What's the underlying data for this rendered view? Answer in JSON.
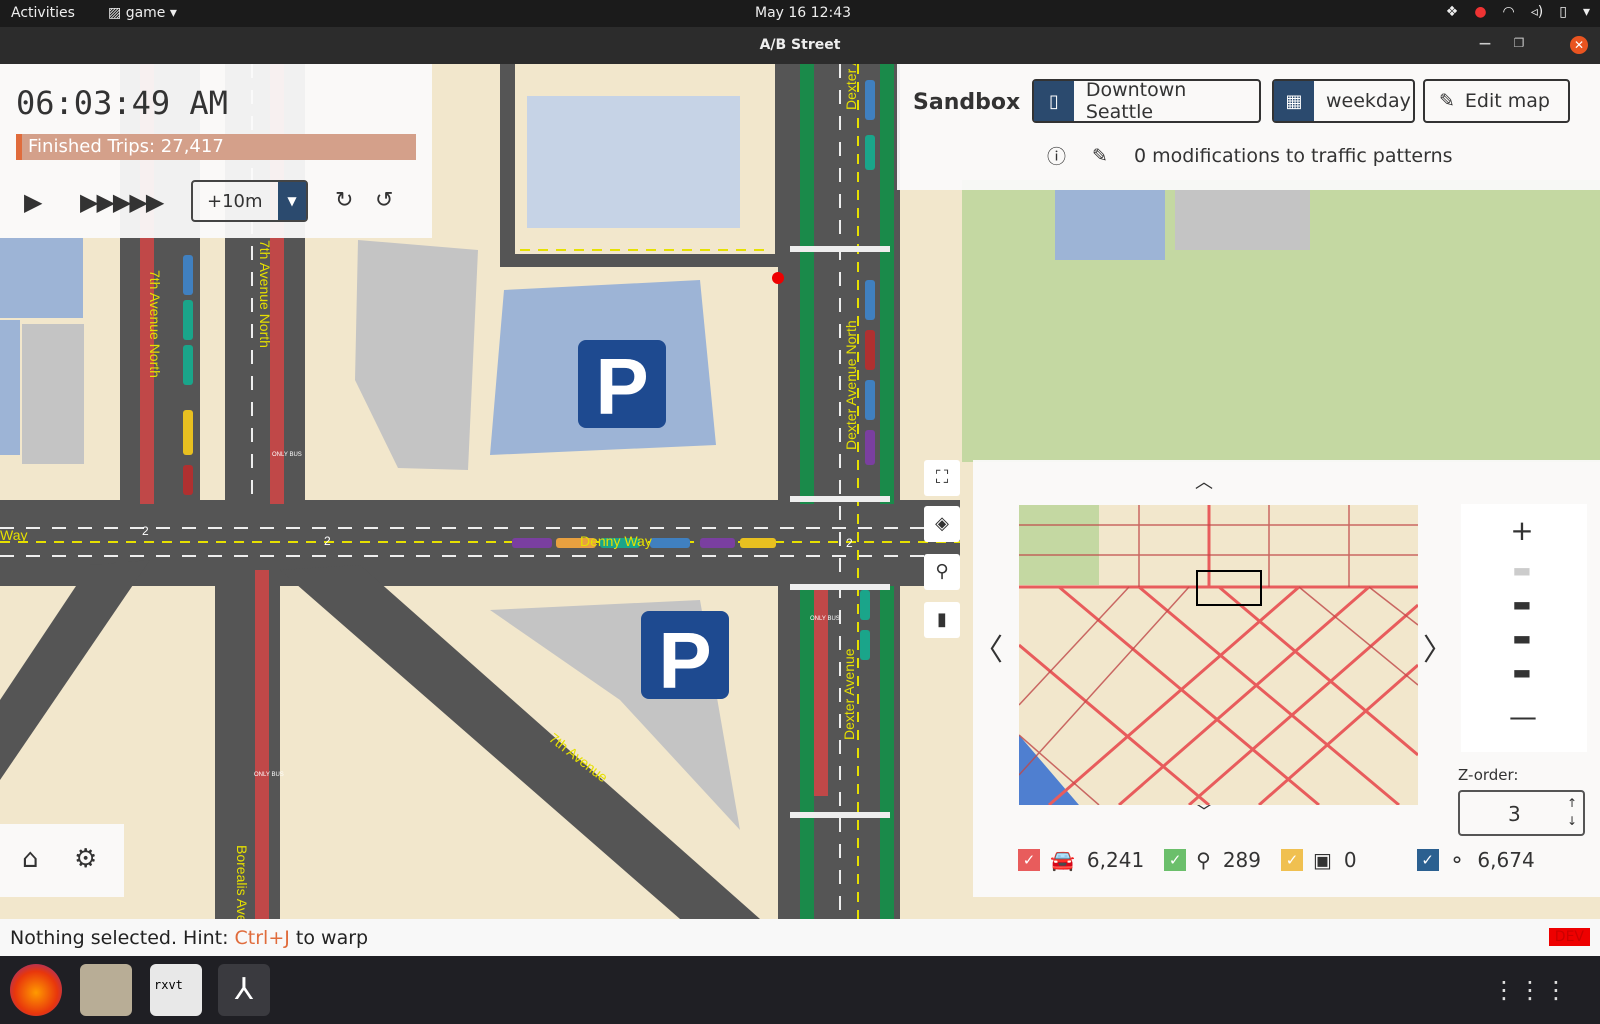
{
  "topbar": {
    "activities": "Activities",
    "app_menu": "game",
    "clock": "May 16  12:43"
  },
  "window": {
    "title": "A/B Street"
  },
  "time_panel": {
    "time": "06:03:49 AM",
    "finished_trips": "Finished Trips: 27,417",
    "step": "+10m",
    "progress_fraction": 0.03
  },
  "sandbox": {
    "label": "Sandbox",
    "map_name": "Downtown Seattle",
    "scenario": "weekday",
    "edit_label": "Edit map",
    "mods_text": "0 modifications to traffic patterns"
  },
  "minimap": {
    "zorder_label": "Z-order:",
    "zorder_value": "3",
    "agents": [
      {
        "name": "car",
        "icon": "car-icon",
        "count": "6,241",
        "color": "#e85c5c"
      },
      {
        "name": "bike",
        "icon": "bike-icon",
        "count": "289",
        "color": "#6bbf6b"
      },
      {
        "name": "bus",
        "icon": "bus-icon",
        "count": "0",
        "color": "#f0c050"
      },
      {
        "name": "pedestrian",
        "icon": "walk-icon",
        "count": "6,674",
        "color": "#2b6090"
      }
    ]
  },
  "map_labels": {
    "street_7th_north": "7th Avenue North",
    "street_7th_north_b": "7th Avenue North",
    "street_dexter_north": "Dexter Avenue North",
    "street_dexter": "Dexter Avenue",
    "street_dexter_top": "Dexter A",
    "street_denny": "Denny Way",
    "street_way_left": "Way",
    "street_7th": "7th Avenue",
    "street_borealis": "Borealis Ave",
    "lane_count_a": "2",
    "lane_count_b": "2",
    "lane_count_c": "2",
    "parking_a": "P",
    "parking_b": "P",
    "only_bus_a": "ONLY BUS",
    "only_bus_b": "ONLY BUS",
    "only_bus_c": "ONLY BUS"
  },
  "statusbar": {
    "hint_prefix": "Nothing selected. Hint: ",
    "hint_key": "Ctrl+J",
    "hint_suffix": " to warp",
    "dev": "DEV"
  },
  "dock": {
    "terminal_text": "rxvt"
  }
}
